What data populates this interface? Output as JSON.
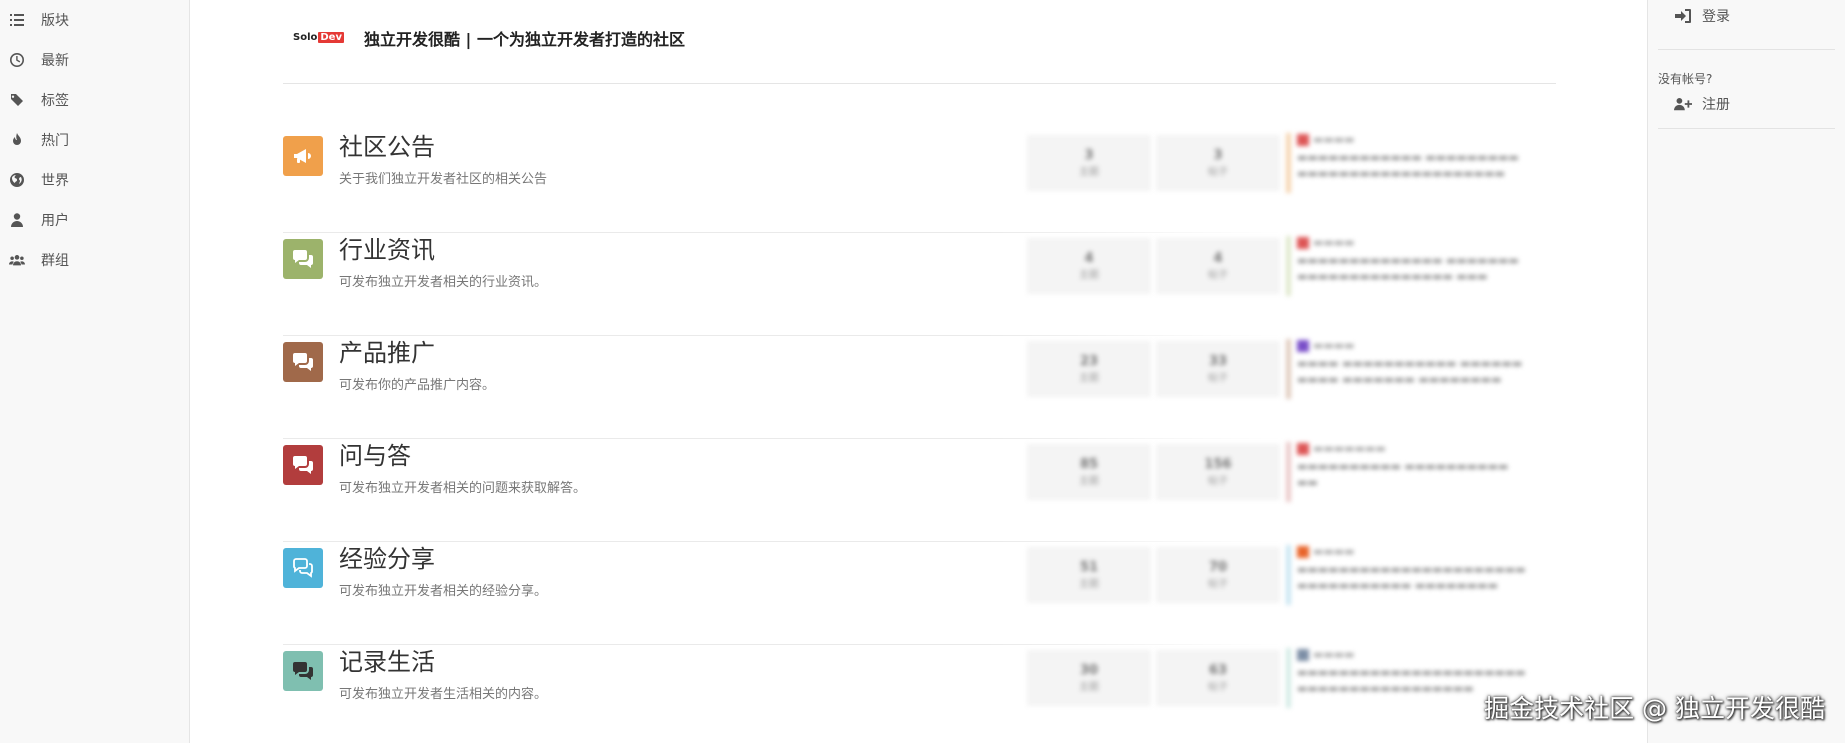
{
  "nav": {
    "items": [
      {
        "label": "版块",
        "icon": "list-icon"
      },
      {
        "label": "最新",
        "icon": "clock-icon"
      },
      {
        "label": "标签",
        "icon": "tags-icon"
      },
      {
        "label": "热门",
        "icon": "fire-icon"
      },
      {
        "label": "世界",
        "icon": "globe-icon"
      },
      {
        "label": "用户",
        "icon": "user-icon"
      },
      {
        "label": "群组",
        "icon": "group-icon"
      }
    ]
  },
  "account": {
    "login_label": "登录",
    "no_account_text": "没有帐号?",
    "register_label": "注册"
  },
  "brand": {
    "logo_solo": "Solo",
    "logo_dev": "Dev",
    "title": "独立开发很酷 | 一个为独立开发者打造的社区"
  },
  "categories": [
    {
      "title": "社区公告",
      "desc": "关于我们独立开发者社区的相关公告",
      "color": "#f0a04b",
      "icon": "bullhorn-icon"
    },
    {
      "title": "行业资讯",
      "desc": "可发布独立开发者相关的行业资讯。",
      "color": "#9cb36b",
      "icon": "comments-icon"
    },
    {
      "title": "产品推广",
      "desc": "可发布你的产品推广内容。",
      "color": "#a0694a",
      "icon": "comments-icon"
    },
    {
      "title": "问与答",
      "desc": "可发布独立开发者相关的问题来获取解答。",
      "color": "#b23d3d",
      "icon": "comments-icon"
    },
    {
      "title": "经验分享",
      "desc": "可发布独立开发者相关的经验分享。",
      "color": "#4fb3d9",
      "icon": "comments-outline-icon"
    },
    {
      "title": "记录生活",
      "desc": "可发布独立开发者生活相关的内容。",
      "color": "#7fbfb0",
      "icon": "comments-icon"
    }
  ],
  "colors": {
    "teaser_borders": [
      "#f6d4b0",
      "#dfe8cc",
      "#e0cbbe",
      "#eac9c9",
      "#c9e6f2",
      "#d3ebe6"
    ],
    "avatar": [
      "#d55",
      "#d55",
      "#7a4fc9",
      "#d55",
      "#e8652b",
      "#7d8fa6"
    ]
  },
  "watermark": "掘金技术社区 @ 独立开发很酷"
}
